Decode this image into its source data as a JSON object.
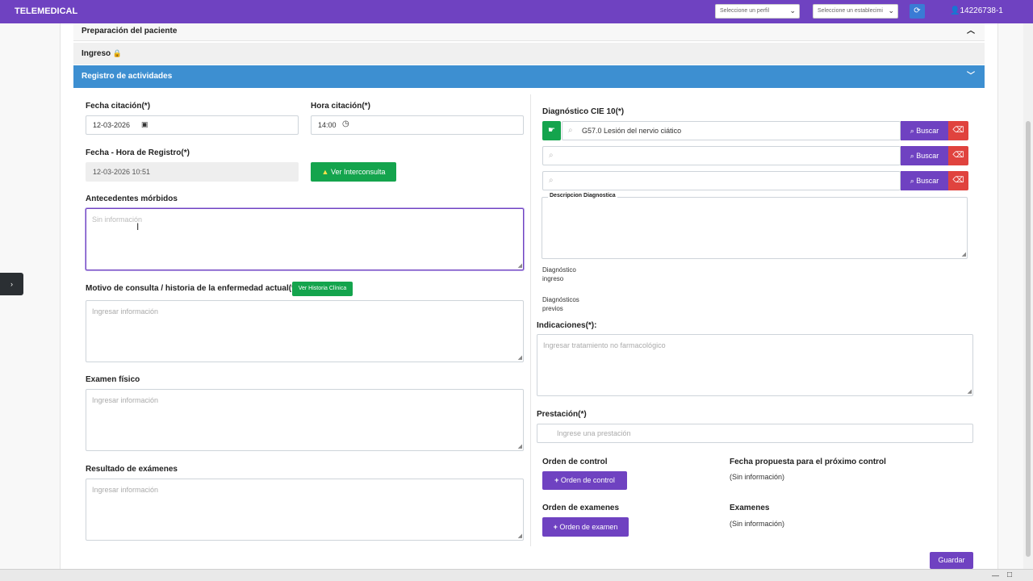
{
  "header": {
    "brand": "TELEMEDICAL",
    "profile_select": "Seleccione un perfil",
    "establishment_select": "Seleccione un establecimi",
    "user_id": "14226738-1"
  },
  "accordion": {
    "prep_title": "Preparación del paciente",
    "ingreso_title": "Ingreso",
    "registro_title": "Registro de actividades"
  },
  "left": {
    "fecha_citacion_label": "Fecha citación(*)",
    "fecha_citacion_value": "12-03-2026",
    "hora_citacion_label": "Hora citación(*)",
    "hora_citacion_value": "14:00",
    "fecha_registro_label": "Fecha - Hora de Registro(*)",
    "fecha_registro_value": "12-03-2026 10:51",
    "ver_interconsulta": "Ver Interconsulta",
    "antecedentes_label": "Antecedentes mórbidos",
    "antecedentes_placeholder": "Sin información",
    "motivo_label": "Motivo de consulta / historia de la enfermedad actual(*)",
    "ver_historia": "Ver Historia Clínica",
    "motivo_placeholder": "Ingresar información",
    "examen_fisico_label": "Examen físico",
    "examen_fisico_placeholder": "Ingresar información",
    "resultado_label": "Resultado de exámenes",
    "resultado_placeholder": "Ingresar información"
  },
  "right": {
    "diagnostico_label": "Diagnóstico CIE 10(*)",
    "diagnostico_value": "G57.0 Lesión del nervio ciático",
    "buscar": "Buscar",
    "descripcion_legend": "Descripcion Diagnostica",
    "diagnostico_ingreso": "Diagnóstico ingreso",
    "diagnosticos_previos": "Diagnósticos previos",
    "indicaciones_label": "Indicaciones(*):",
    "indicaciones_placeholder": "Ingresar tratamiento no farmacológico",
    "prestacion_label": "Prestación(*)",
    "prestacion_placeholder": "Ingrese una prestación",
    "orden_control_label": "Orden de control",
    "orden_control_button": "Orden de control",
    "fecha_propuesta_label": "Fecha propuesta para el próximo control",
    "fecha_propuesta_value": "(Sin información)",
    "orden_examenes_label": "Orden de examenes",
    "orden_examen_button": "Orden de examen",
    "examenes_label": "Examenes",
    "examenes_value": "(Sin información)",
    "guardar": "Guardar"
  },
  "colors": {
    "header": "#6f42c1",
    "accordion_active": "#3d8fd1",
    "success": "#14a44d",
    "danger": "#e0433e"
  }
}
